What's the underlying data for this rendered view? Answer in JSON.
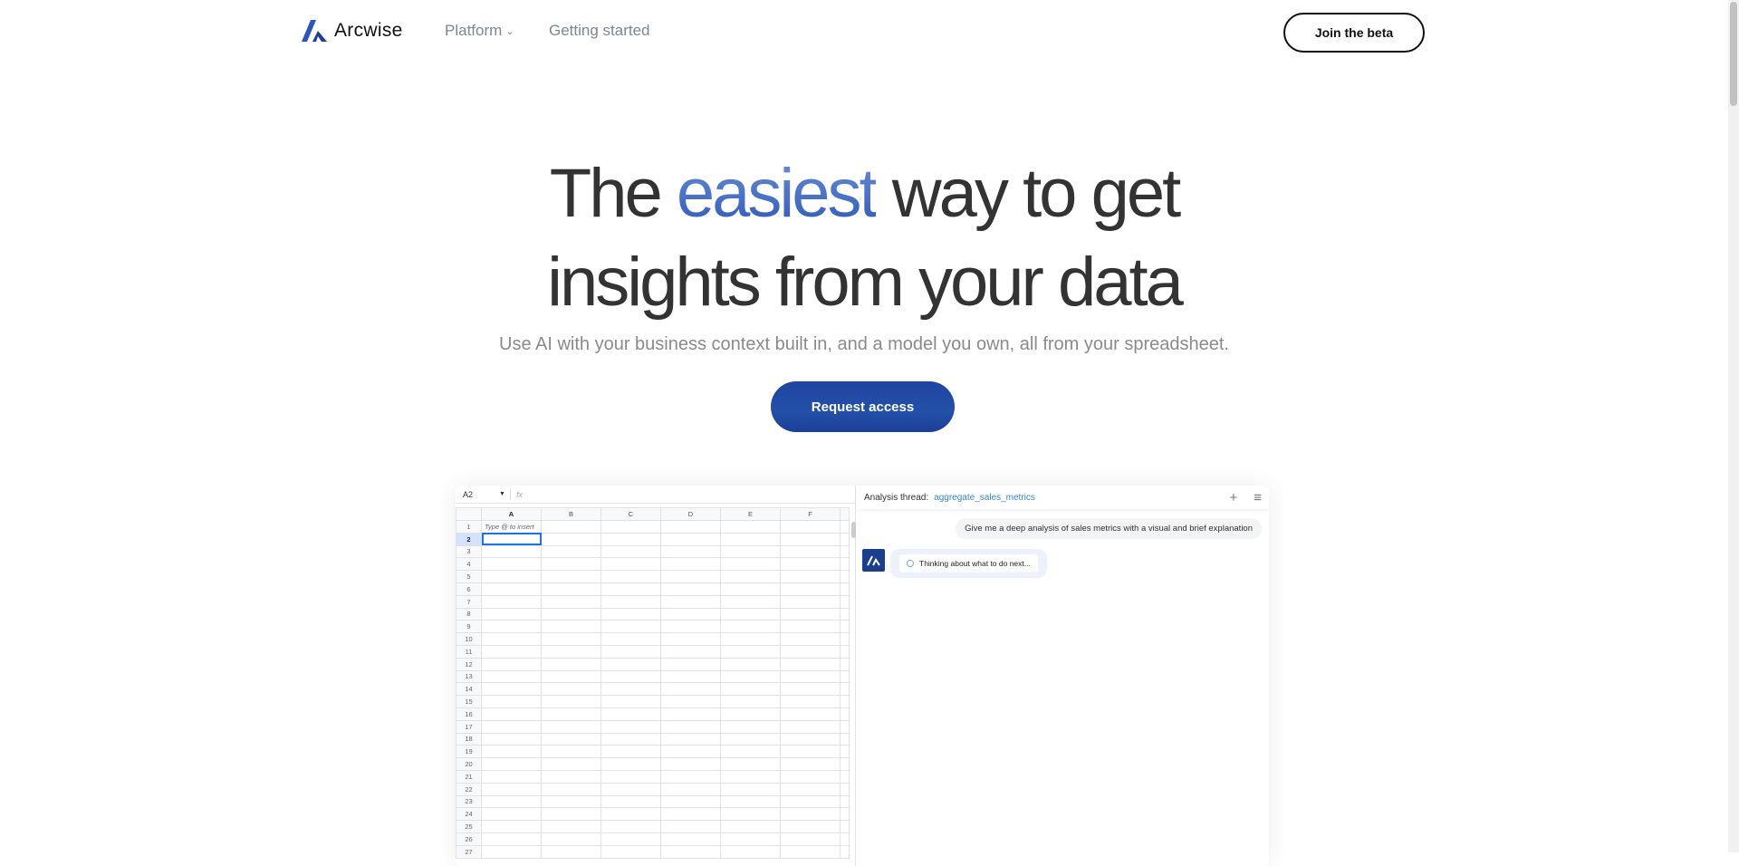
{
  "nav": {
    "brand": "Arcwise",
    "links": [
      {
        "label": "Platform",
        "has_dropdown": true
      },
      {
        "label": "Getting started"
      }
    ],
    "cta": "Join the beta"
  },
  "hero": {
    "line1_pre": "The",
    "line1_highlight": "easiest",
    "line1_post": "way to get",
    "line2": "insights from your data",
    "subtitle": "Use AI with your business context built in, and a model you own, all from your spreadsheet.",
    "cta": "Request access"
  },
  "sheet": {
    "cell_ref": "A2",
    "fx": "fx",
    "columns": [
      "A",
      "B",
      "C",
      "D",
      "E",
      "F"
    ],
    "selected_column": "A",
    "selected_row": 2,
    "a1_hint": "Type @ to insert",
    "row_count": 27
  },
  "chat": {
    "thread_label": "Analysis thread:",
    "thread_name": "aggregate_sales_metrics",
    "user_message": "Give me a deep analysis of sales metrics with a visual and brief explanation",
    "status": "Thinking about what to do next..."
  },
  "colors": {
    "accent": "#2450a8",
    "link": "#3a82c9",
    "selection": "#1a73e8"
  }
}
